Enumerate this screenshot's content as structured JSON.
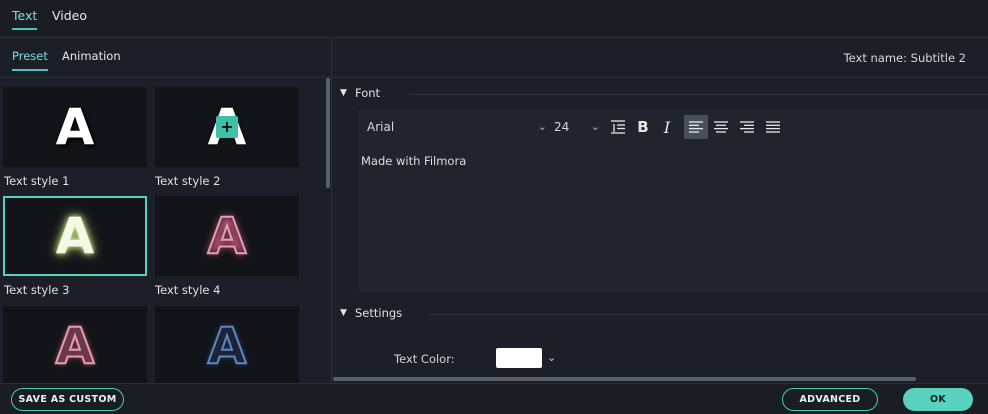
{
  "top_tabs": [
    {
      "label": "Text",
      "active": true
    },
    {
      "label": "Video",
      "active": false
    }
  ],
  "left_panel": {
    "sub_tabs": [
      {
        "label": "Preset",
        "active": true
      },
      {
        "label": "Animation",
        "active": false
      }
    ],
    "styles": [
      {
        "label": "Text style 1",
        "glyph": "A"
      },
      {
        "label": "Text style 2",
        "glyph": "A"
      },
      {
        "label": "Text style 3",
        "glyph": "A",
        "selected": true
      },
      {
        "label": "Text style 4",
        "glyph": "A"
      },
      {
        "label": "",
        "glyph": "A"
      },
      {
        "label": "",
        "glyph": "A"
      }
    ],
    "add_badge": "+"
  },
  "right_panel": {
    "text_name": "Text name: Subtitle 2",
    "font_section": {
      "title": "Font",
      "font_family": "Arial",
      "font_size": "24",
      "text_content": "Made with Filmora",
      "align_active": "left"
    },
    "settings_section": {
      "title": "Settings",
      "text_color_label": "Text Color:",
      "text_color": "#ffffff"
    }
  },
  "bottom": {
    "save_custom": "SAVE AS CUSTOM",
    "advanced": "ADVANCED",
    "ok": "OK"
  },
  "colors": {
    "accent": "#49c5b2",
    "background": "#1d1f28",
    "panel": "#21242d"
  }
}
